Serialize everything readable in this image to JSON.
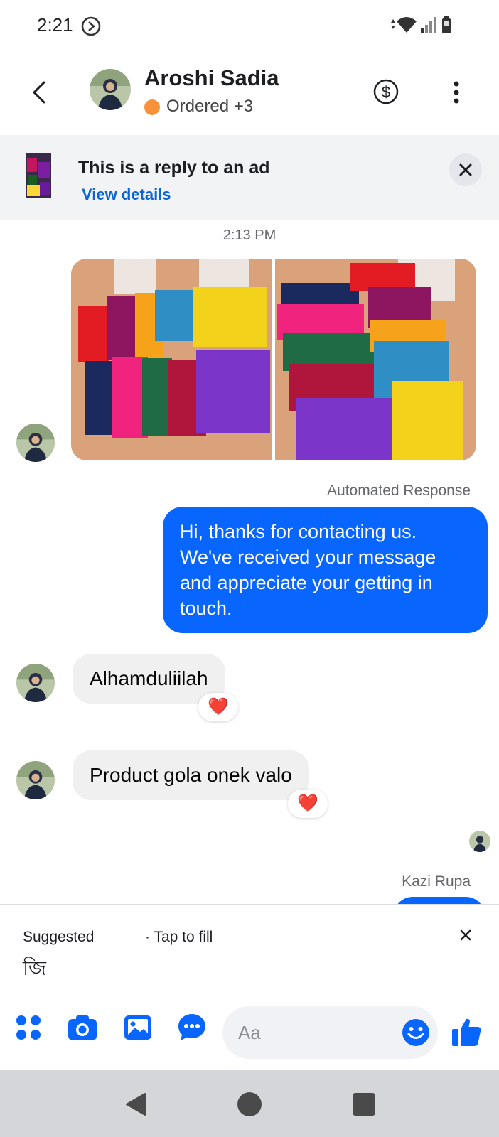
{
  "status_bar": {
    "time": "2:21"
  },
  "header": {
    "contact_name": "Aroshi Sadia",
    "order_status": "Ordered",
    "extra_labels": "+3",
    "colors": {
      "order_dot": "#f7923a"
    }
  },
  "ad_banner": {
    "title": "This is a reply to an ad",
    "link": "View details"
  },
  "chat": {
    "timestamp": "2:13 PM",
    "automated_label": "Automated Response",
    "outgoing_message": "Hi, thanks for contacting us. We've received your message and appreciate your getting in touch.",
    "incoming_messages": [
      {
        "text": "Alhamduliilah",
        "reaction": "❤️"
      },
      {
        "text": "Product gola onek valo",
        "reaction": "❤️"
      }
    ],
    "next_sender": "Kazi Rupa",
    "colors": {
      "outgoing_bubble": "#0866ff",
      "incoming_bubble": "#f0f0f0",
      "reaction_heart": "#e41e3f"
    }
  },
  "suggestions": {
    "title": "Suggested",
    "hint": "· Tap to fill",
    "word": "জি"
  },
  "composer": {
    "placeholder": "Aa",
    "icons": [
      "apps-icon",
      "camera-icon",
      "gallery-icon",
      "chat-bubble-icon",
      "emoji-icon",
      "thumbs-up-icon"
    ],
    "accent": "#0866ff"
  },
  "nav_bar": {
    "buttons": [
      "back-triangle",
      "home-circle",
      "recents-square"
    ]
  }
}
